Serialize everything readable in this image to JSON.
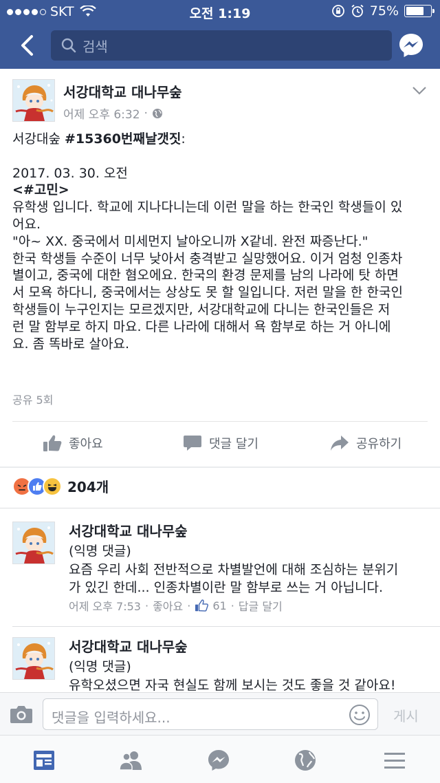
{
  "status_bar": {
    "carrier": "SKT",
    "time": "오전 1:19",
    "battery": "75%",
    "battery_level": 0.75
  },
  "nav": {
    "search_placeholder": "검색",
    "icons": [
      "back-icon",
      "search-icon",
      "messenger-icon"
    ]
  },
  "post": {
    "page_name": "서강대학교 대나무숲",
    "time": "어제 오후 6:32",
    "audience_icon": "globe-icon",
    "line1_prefix": "서강대숲 ",
    "line1_hashtag": "#15360번째날갯짓",
    "line1_suffix": ":",
    "date_line": "2017. 03. 30. 오전",
    "tag_line": "<#고민>",
    "lines": [
      "유학생 입니다. 학교에 지나다니는데 이런 말을 하는 한국인 학생들이 있",
      "어요.",
      "\"아~ XX. 중국에서 미세먼지 날아오니까 X같네. 완전 짜증난다.\"",
      "한국 학생들 수준이 너무 낮아서 충격받고 실망했어요. 이거 엄청 인종차",
      "별이고, 중국에 대한 혐오에요. 한국의 환경 문제를 남의 나라에 탓 하면",
      "서 모욕 하다니, 중국에서는 상상도 못 할 일입니다. 저런 말을 한 한국인",
      "학생들이 누구인지는 모르겠지만, 서강대학교에 다니는 한국인들은 저",
      "런 말 함부로 하지 마요. 다른 나라에 대해서 욕 함부로 하는 거 아니에",
      "요. 좀 똑바로 살아요."
    ],
    "shares": "공유 5회",
    "actions": {
      "like": "좋아요",
      "comment": "댓글 달기",
      "share": "공유하기"
    }
  },
  "reactions": {
    "types": [
      "angry",
      "like",
      "haha"
    ],
    "count": "204개"
  },
  "comments": [
    {
      "name": "서강대학교 대나무숲",
      "lines": [
        "(익명 댓글)",
        "요즘 우리 사회 전반적으로 차별발언에 대해 조심하는 분위기",
        "가 있긴 한데... 인종차별이란 말 함부로 쓰는 거 아닙니다."
      ],
      "time": "어제 오후 7:53",
      "like_label": "좋아요",
      "like_count": "61",
      "reply_label": "답글 달기"
    },
    {
      "name": "서강대학교 대나무숲",
      "lines": [
        "(익명 댓글)",
        "유학오셨으면 자국 현실도 함께 보시는 것도 좋을 것 같아요!"
      ]
    }
  ],
  "comment_input": {
    "placeholder": "댓글을 입력하세요...",
    "post_label": "게시"
  },
  "tabbar": {
    "items": [
      "news-feed-icon",
      "friends-icon",
      "messenger-icon",
      "notifications-globe-icon",
      "menu-icon"
    ],
    "active_index": 0,
    "active_color": "#4267b2",
    "inactive_color": "#8d949e"
  },
  "colors": {
    "brand": "#3b5998",
    "link": "#4267b2",
    "muted": "#90949c"
  }
}
